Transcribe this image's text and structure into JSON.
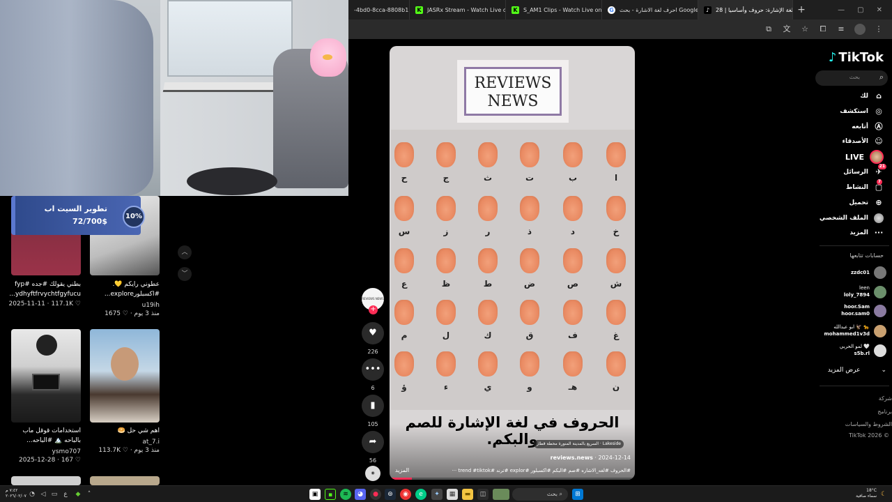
{
  "browser": {
    "tabs": [
      {
        "label": "-4bd0-8cca-8808b1",
        "favicon": "",
        "color": "#555555",
        "active": false
      },
      {
        "label": "JASRx Stream - Watch Live on Kick",
        "favicon": "K",
        "color": "#53fc18",
        "active": false
      },
      {
        "label": "S_AM1 Clips - Watch Live on Kick",
        "favicon": "K",
        "color": "#53fc18",
        "active": false
      },
      {
        "label": "احرف لغة الاشارة - بحث Google",
        "favicon": "G",
        "color": "#ffffff",
        "active": false
      },
      {
        "label": "تعلم لغة الإشارة: حروف وأساسيا | 28",
        "favicon": "♪",
        "color": "#000000",
        "active": true
      }
    ],
    "new_tab": "+"
  },
  "banner": {
    "title": "تطوير السيت اب",
    "amount": "72/700$",
    "percent": "10%"
  },
  "profile_videos": [
    {
      "caption": "عطوني رايكم 💛.",
      "caption2": "#اكسبلورexplore...",
      "user": "u19ih",
      "stats": "1675 ♡ · منذ 3 يوم"
    },
    {
      "caption": "بطني يقولك #جده #fyp",
      "caption2": "ydhyftfrvychtfgyfucu...",
      "user": "",
      "stats": "2025-11-11 · 117.1K ♡"
    },
    {
      "caption": "اهم شي حل 🥯",
      "caption2": "",
      "user": "at_7.i",
      "stats": "113.7K ♡ · منذ 3 يوم"
    },
    {
      "caption": "استخدامات قوقل ماب",
      "caption2": "بالباحه 🏔️ #الباحه...",
      "user": "ysmo707",
      "stats": "2025-12-28 · 167 ♡"
    }
  ],
  "video": {
    "logo_line1": "REVIEWS",
    "logo_line2": "NEWS",
    "letters_row1": [
      "ح",
      "ج",
      "ث",
      "ت",
      "ب",
      "ا"
    ],
    "letters_row2": [
      "س",
      "ز",
      "ر",
      "ذ",
      "د",
      "خ"
    ],
    "letters_row3": [
      "ع",
      "ظ",
      "ط",
      "ض",
      "ص",
      "ش"
    ],
    "letters_row4": [
      "م",
      "ل",
      "ك",
      "ق",
      "ف",
      "غ"
    ],
    "letters_row5": [
      "ؤ",
      "ء",
      "ي",
      "و",
      "هـ",
      "ن"
    ],
    "title": "الحروف في لغة الإشارة للصم والبكم.",
    "music": "Lakeside · السريع بالمدينة المنورة محطة قطار",
    "author": "reviews.news",
    "date": "2024-12-14",
    "tags": "#الحروف #لغه_الاشاره #صم #البكم #اكسبلور #explor #ترند #trend #tiktok ···",
    "more": "المزيد",
    "progress": 0.09
  },
  "actions": {
    "likes": "226",
    "comments": "6",
    "saves": "105",
    "shares": "56",
    "avatar_text": "REVIEWS NEWS"
  },
  "sidebar": {
    "brand": "TikTok",
    "search_placeholder": "بحث",
    "nav": [
      {
        "label": "لك",
        "icon": "home-icon",
        "glyph": "⌂"
      },
      {
        "label": "استكشف",
        "icon": "compass-icon",
        "glyph": "◎"
      },
      {
        "label": "أتابعه",
        "icon": "following-icon",
        "glyph": "Ⓐ"
      },
      {
        "label": "الأصدقاء",
        "icon": "friends-icon",
        "glyph": "☺"
      },
      {
        "label": "LIVE",
        "icon": "live-icon",
        "glyph": ""
      },
      {
        "label": "الرسائل",
        "icon": "messages-icon",
        "glyph": "✈",
        "badge": "21"
      },
      {
        "label": "النشاط",
        "icon": "activity-icon",
        "glyph": "▢",
        "badge": "7"
      },
      {
        "label": "تحميل",
        "icon": "upload-icon",
        "glyph": "⊕"
      },
      {
        "label": "الملف الشخصي",
        "icon": "profile-icon",
        "glyph": ""
      },
      {
        "label": "المزيد",
        "icon": "more-icon",
        "glyph": "···"
      }
    ],
    "following_header": "حسابات تتابعها",
    "accounts": [
      {
        "name": "zzdc01",
        "handle": "",
        "color": "#777777"
      },
      {
        "name": "leen",
        "handle": "loly_7894",
        "color": "#6b8f6b"
      },
      {
        "name": "hoor.Sam",
        "handle": "hoor.sam0",
        "color": "#8a7aa0"
      },
      {
        "name": "ابو عبدالله 🦅 🐆",
        "handle": "mohammed1v3d",
        "color": "#c9a070"
      },
      {
        "name": "لمو الحربي 🤍",
        "handle": "s5b.rl",
        "color": "#dddddd"
      }
    ],
    "show_more": "عرض المزيد",
    "footer": [
      "شركة",
      "برنامج",
      "الشروط والسياسات",
      "TikTok 2026 ©"
    ]
  },
  "taskbar": {
    "search": "بحث",
    "clock_time": "٧:٤٢ م",
    "clock_date": "٢٠٢٦/٠٢/٠٧",
    "weather_temp": "18°C",
    "weather_desc": "سماء صافية"
  }
}
